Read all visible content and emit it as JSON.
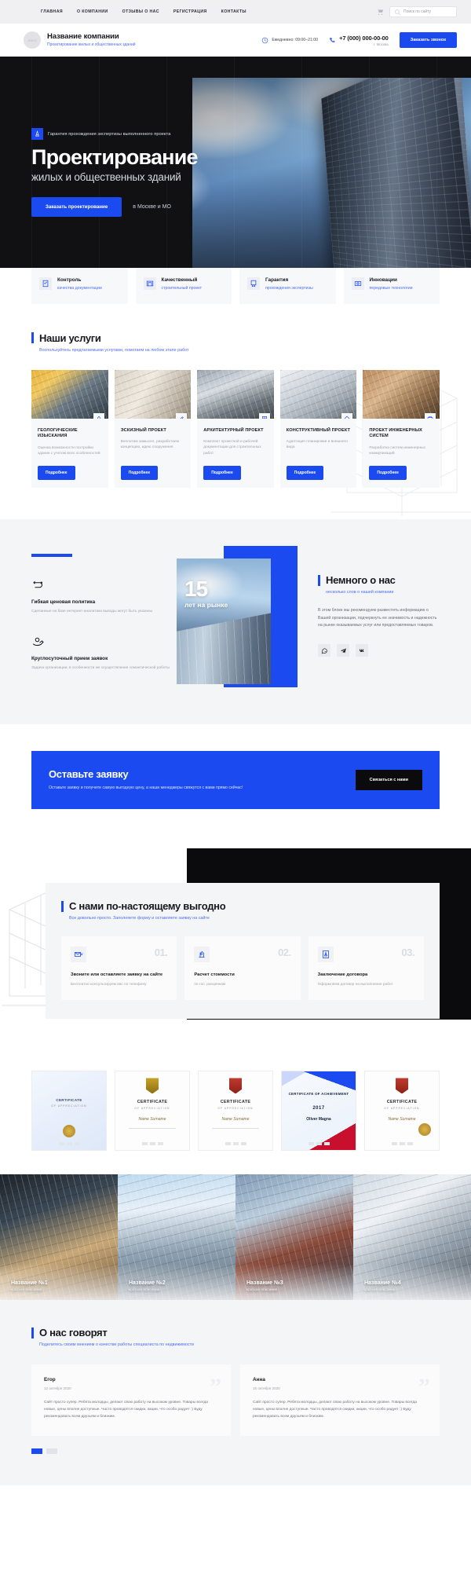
{
  "topbar": {
    "nav": [
      {
        "label": "ГЛАВНАЯ"
      },
      {
        "label": "О КОМПАНИИ"
      },
      {
        "label": "ОТЗЫВЫ О НАС"
      },
      {
        "label": "РЕГИСТРАЦИЯ"
      },
      {
        "label": "КОНТАКТЫ"
      }
    ],
    "cart_icon": "cart-icon",
    "search_placeholder": "Поиск по сайту",
    "search_value": "",
    "search_icon": "search-icon"
  },
  "header": {
    "logo_text": "ЛОГО",
    "brand_name": "Название компании",
    "brand_sub": "Проектирование жилых и общественных зданий",
    "hours_icon": "clock-icon",
    "hours": "Ежедневно: 09:00–21:00",
    "phone_icon": "phone-icon",
    "phone": "+7 (000) 000-00-00",
    "city": "г. Москва",
    "callback_label": "Заказать звонок"
  },
  "hero": {
    "badge_icon": "compass-icon",
    "badge_text": "Гарантия прохождения экспертизы выполненного проекта",
    "title": "Проектирование",
    "subtitle": "жилых и общественных зданий",
    "cta_label": "Заказать проектирование",
    "region": "в Москве и МО"
  },
  "features": [
    {
      "icon": "document-check-icon",
      "title": "Контроль",
      "sub": "качества документации"
    },
    {
      "icon": "blueprint-icon",
      "title": "Качественный",
      "sub": "строительный проект"
    },
    {
      "icon": "certificate-icon",
      "title": "Гарантия",
      "sub": "прохождения экспертизы"
    },
    {
      "icon": "innovation-icon",
      "title": "Инновации",
      "sub": "передовые технологии"
    }
  ],
  "services": {
    "title": "Наши услуги",
    "subtitle": "Воспользуйтесь предлагаемыми услугами, помогаем на любом этапе работ",
    "items": [
      {
        "title": "ГЕОЛОГИЧЕСКИЕ ИЗЫСКАНИЯ",
        "desc": "Оценка возможности постройки здания с учетом всех особенностей",
        "button": "Подробнее",
        "badge_icon": "geology-icon"
      },
      {
        "title": "ЭСКИЗНЫЙ ПРОЕКТ",
        "desc": "Воплотим замысел, разработаем концепцию, идею сооружения",
        "button": "Подробнее",
        "badge_icon": "sketch-icon"
      },
      {
        "title": "АРХИТЕКТУРНЫЙ ПРОЕКТ",
        "desc": "Комплект проектной и рабочей документации для строительных работ",
        "button": "Подробнее",
        "badge_icon": "architecture-icon"
      },
      {
        "title": "КОНСТРУКТИВНЫЙ ПРОЕКТ",
        "desc": "Адаптация планировки и внешнего вида",
        "button": "Подробнее",
        "badge_icon": "structure-icon"
      },
      {
        "title": "ПРОЕКТ ИНЖЕНЕРНЫХ СИСТЕМ",
        "desc": "Разработка систем инженерных коммуникаций",
        "button": "Подробнее",
        "badge_icon": "engineering-icon"
      }
    ]
  },
  "about": {
    "advantages": [
      {
        "icon": "price-tag-icon",
        "title": "Гибкая ценовая политика",
        "desc": "Сделанные на базе интернет-аналитики выводы могут быть указаны"
      },
      {
        "icon": "hand-support-icon",
        "title": "Круглосуточный прием заявок",
        "desc": "Задача организации, в особенности же осуществление семантической работы"
      }
    ],
    "promo_number": "15",
    "promo_label": "лет на рынке",
    "title": "Немного о нас",
    "subtitle": "несколько слов о нашей компании",
    "text": "В этом блоке мы рекомендуем разместить информацию о Вашей организации, подчеркнуть ее значимость и надежность на рынке оказываемых услуг или предоставляемых товаров.",
    "socials": [
      {
        "icon": "whatsapp-icon",
        "name": "WhatsApp"
      },
      {
        "icon": "telegram-icon",
        "name": "Telegram"
      },
      {
        "icon": "vk-icon",
        "name": "VK"
      }
    ]
  },
  "cta": {
    "title": "Оставьте заявку",
    "subtitle": "Оставьте заявку и получите самую выгодную цену, а наши менеджеры свяжутся с вами прямо сейчас!",
    "button": "Связаться с нами"
  },
  "steps": {
    "title": "С нами по-настоящему выгодно",
    "subtitle": "Все довольно просто. Заполняете форму и оставляете заявку на сайте",
    "items": [
      {
        "icon": "mail-send-icon",
        "number": "01.",
        "title": "Звоните или оставляете заявку на сайте",
        "desc": "Бесплатно консультируем вас по телефону"
      },
      {
        "icon": "calculator-icon",
        "number": "02.",
        "title": "Расчет стоимости",
        "desc": "по гос. расценкам"
      },
      {
        "icon": "contract-icon",
        "number": "03.",
        "title": "Заключение договора",
        "desc": "Оформляем договор на выполнение работ"
      }
    ]
  },
  "certificates": [
    {
      "title": "CERTIFICATE",
      "sub": "OF APPRECIATION",
      "name": "",
      "style": "c1",
      "seal": "gold-seal-icon"
    },
    {
      "title": "CERTIFICATE",
      "sub": "OF APPRECIATION",
      "name": "Name Surname",
      "style": "c2",
      "seal": "ribbon-icon"
    },
    {
      "title": "CERTIFICATE",
      "sub": "OF APPRECIATION",
      "name": "Name Surname",
      "style": "c3",
      "seal": "ribbon-icon"
    },
    {
      "title": "CERTIFICATE OF ACHIEVEMENT",
      "sub": "2017",
      "name": "Oliver Magna",
      "style": "c4",
      "seal": "medal-icon"
    },
    {
      "title": "CERTIFICATE",
      "sub": "OF APPRECIATION",
      "name": "Name Surname",
      "style": "c5",
      "seal": "ribbon-icon"
    }
  ],
  "gallery": [
    {
      "title": "Название №1",
      "sub": "краткое описание"
    },
    {
      "title": "Название №2",
      "sub": "краткое описание"
    },
    {
      "title": "Название №3",
      "sub": "краткое описание"
    },
    {
      "title": "Название №4",
      "sub": "краткое описание"
    }
  ],
  "reviews": {
    "title": "О нас говорят",
    "subtitle": "Поделитесь своим мнением о качестве работы специалиста по недвижимости",
    "items": [
      {
        "name": "Егор",
        "date": "12 октября 2020",
        "text": "Сайт просто супер. Ребята молодцы, делают свою работу на высоком уровне. Товары всегда новые, цены вполне доступные. Часто проводятся скидки, акции, что особо радует :) Буду рекомендовать всем друзьям и близким."
      },
      {
        "name": "Анна",
        "date": "15 октября 2020",
        "text": "Сайт просто супер. Ребята молодцы, делают свою работу на высоком уровне. Товары всегда новые, цены вполне доступные. Часто проводятся скидки, акции, что особо радует :) Буду рекомендовать всем друзьям и близким."
      }
    ],
    "pages": [
      {
        "active": true
      },
      {
        "active": false
      }
    ]
  },
  "colors": {
    "accent": "#1b4bf0",
    "dark": "#0b0b0e",
    "light_bg": "#f4f5f7",
    "muted": "#a0a0ab"
  }
}
